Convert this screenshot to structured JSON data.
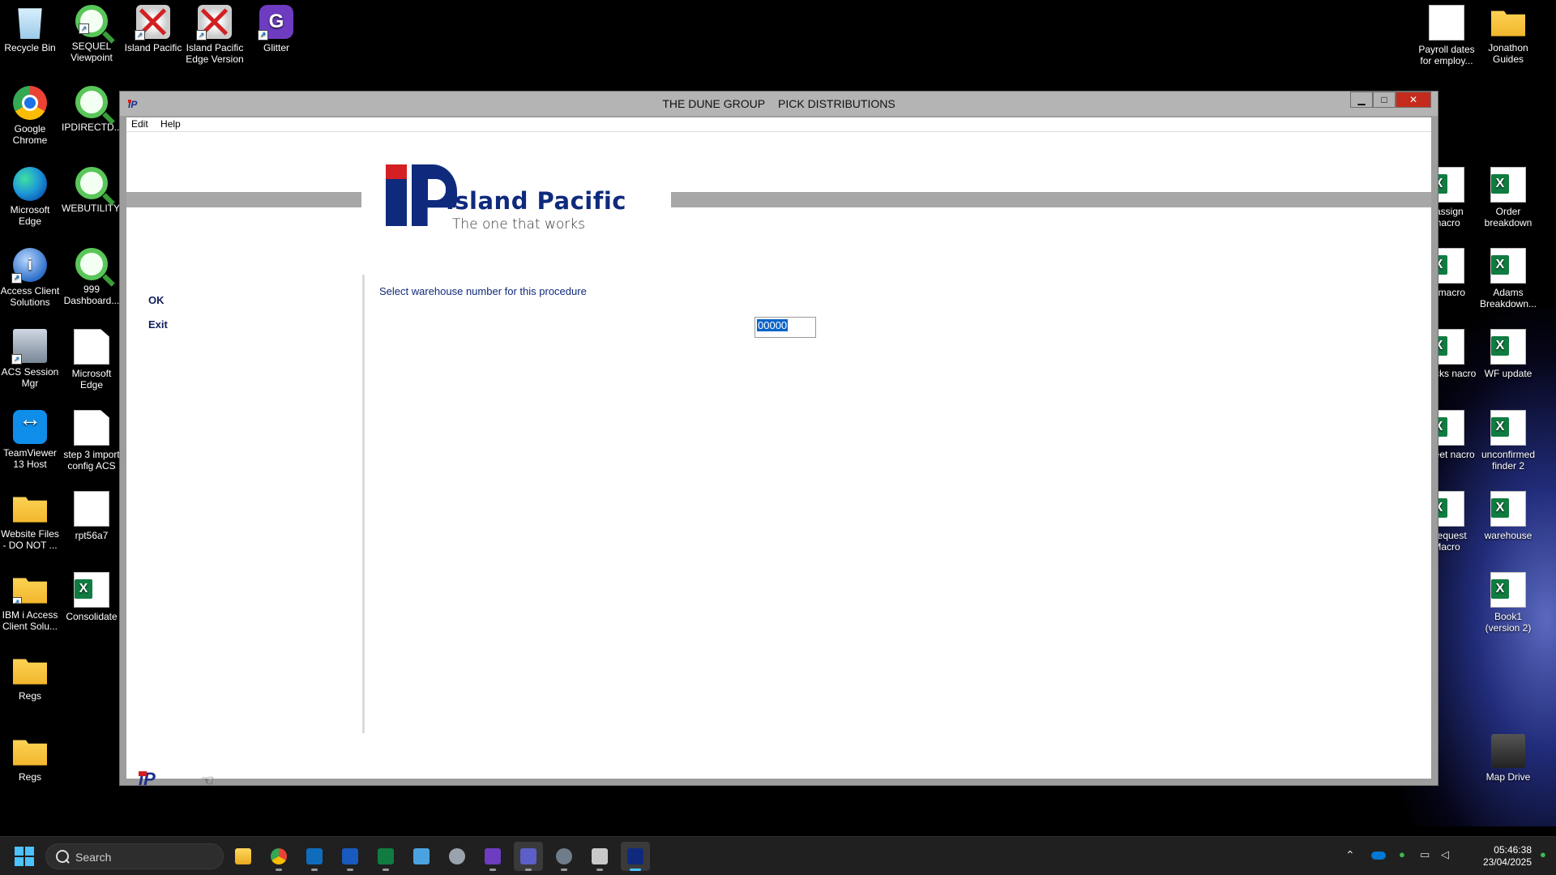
{
  "desktop": {
    "left_icons": [
      {
        "label": "Recycle Bin",
        "icon": "recycle-bin-icon"
      },
      {
        "label": "SEQUEL Viewpoint",
        "icon": "sequel-icon"
      },
      {
        "label": "Island Pacific",
        "icon": "island-pacific-icon"
      },
      {
        "label": "Island Pacific Edge Version",
        "icon": "island-pacific-icon"
      },
      {
        "label": "Glitter",
        "icon": "glitter-icon"
      },
      {
        "label": "Google Chrome",
        "icon": "chrome-icon"
      },
      {
        "label": "IPDIRECTD...",
        "icon": "sequel-icon"
      },
      {
        "label": "Microsoft Edge",
        "icon": "edge-icon"
      },
      {
        "label": "WEBUTILITY...",
        "icon": "sequel-icon"
      },
      {
        "label": "Access Client Solutions",
        "icon": "access-client-icon"
      },
      {
        "label": "999 Dashboard...",
        "icon": "sequel-icon"
      },
      {
        "label": "ACS Session Mgr",
        "icon": "acs-session-icon"
      },
      {
        "label": "Microsoft Edge",
        "icon": "document-icon"
      },
      {
        "label": "TeamViewer 13 Host",
        "icon": "teamviewer-icon"
      },
      {
        "label": "step 3 import config ACS",
        "icon": "document-icon"
      },
      {
        "label": "Website Files - DO NOT ...",
        "icon": "folder-icon"
      },
      {
        "label": "rpt56a7",
        "icon": "report-icon"
      },
      {
        "label": "IBM i Access Client Solu...",
        "icon": "folder-icon"
      },
      {
        "label": "Consolidate",
        "icon": "excel-icon"
      },
      {
        "label": "Regs",
        "icon": "folder-icon"
      },
      {
        "label": "Regs",
        "icon": "folder-icon"
      }
    ],
    "right_icons": [
      {
        "label": "Payroll dates for employ...",
        "icon": "payroll-doc-icon"
      },
      {
        "label": "Jonathon Guides",
        "icon": "folder-icon"
      },
      {
        "label": "eassign macro",
        "icon": "excel-icon"
      },
      {
        "label": "Order breakdown",
        "icon": "excel-icon"
      },
      {
        "label": "ts macro",
        "icon": "excel-icon"
      },
      {
        "label": "Adams Breakdown...",
        "icon": "excel-icon"
      },
      {
        "label": "sspicks nacro",
        "icon": "excel-icon"
      },
      {
        "label": "WF update",
        "icon": "excel-icon"
      },
      {
        "label": "nsheet nacro",
        "icon": "excel-icon"
      },
      {
        "label": "unconfirmed finder 2",
        "icon": "excel-icon"
      },
      {
        "label": "s request Macro",
        "icon": "excel-icon"
      },
      {
        "label": "warehouse",
        "icon": "excel-icon"
      },
      {
        "label": "Book1 (version 2)",
        "icon": "excel-icon"
      },
      {
        "label": "Map Drive",
        "icon": "map-drive-icon"
      }
    ]
  },
  "window": {
    "title_company": "THE DUNE GROUP",
    "title_screen": "PICK DISTRIBUTIONS",
    "menu": [
      "Edit",
      "Help"
    ],
    "logo_title": "Island Pacific",
    "logo_tagline": "The one that works",
    "side_options": [
      "OK",
      "Exit"
    ],
    "prompt_label": "Select warehouse number for this procedure",
    "warehouse_value": "00000",
    "controls": {
      "minimize": "▁",
      "maximize": "□",
      "close": "✕"
    }
  },
  "taskbar": {
    "search_placeholder": "Search",
    "apps": [
      "file-explorer-icon",
      "chrome-icon",
      "outlook-icon",
      "word-icon",
      "excel-icon",
      "notepad-icon",
      "settings-icon",
      "glitter-icon",
      "teams-icon",
      "settings-gear-icon",
      "app-icon",
      "island-pacific-icon"
    ],
    "clock_time": "05:46:38",
    "clock_date": "23/04/2025"
  },
  "colors": {
    "brand_blue": "#0f2a7d",
    "brand_red": "#d41f24",
    "selection": "#0a64c8",
    "close_button": "#c42b1c"
  }
}
